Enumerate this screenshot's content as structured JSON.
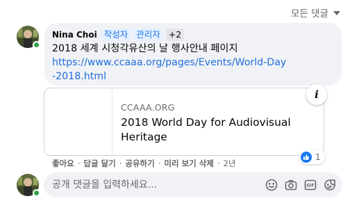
{
  "sort": {
    "label": "모든 댓글"
  },
  "comment": {
    "author": "Nina Choi",
    "badges": [
      "작성자",
      "관리자"
    ],
    "extra_badges": "+2",
    "text": "2018 세계 시청각유산의 날 행사안내 페이지",
    "link": "https://www.ccaaa.org/pages/Events/World-Day-2018.html",
    "preview": {
      "domain": "CCAAA.ORG",
      "title": "2018 World Day for Audiovisual Heritage"
    },
    "reactions": {
      "icon": "like-icon",
      "count": "1"
    },
    "actions": {
      "like": "좋아요",
      "reply": "답글 달기",
      "share": "공유하기",
      "preview_delete": "미리 보기 삭제",
      "age": "2년"
    }
  },
  "composer": {
    "placeholder": "공개 댓글을 입력하세요...",
    "tools": [
      "emoji-icon",
      "camera-icon",
      "gif-icon",
      "sticker-icon"
    ]
  },
  "colors": {
    "accent": "#1877f2",
    "link": "#216fdb",
    "bubble": "#f0f2f5",
    "muted": "#65676b",
    "online": "#31a24c"
  }
}
